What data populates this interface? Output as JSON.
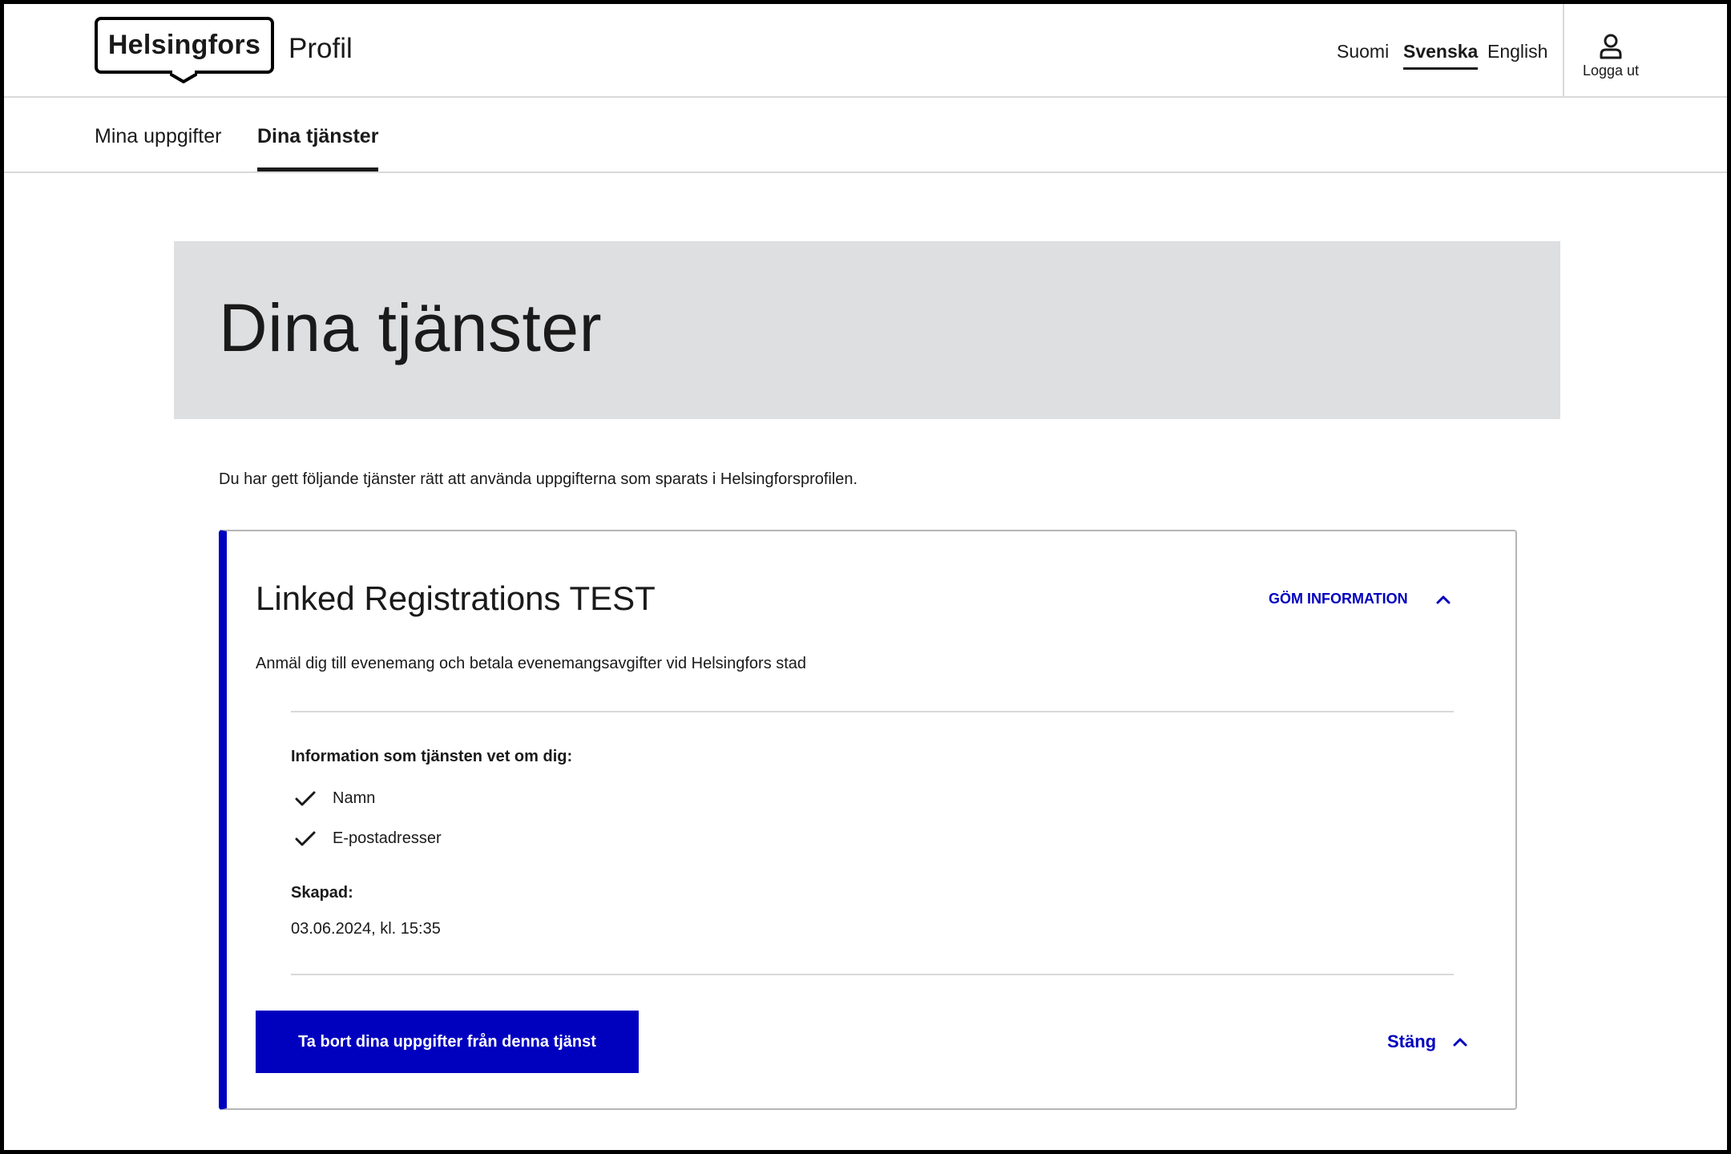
{
  "header": {
    "logo_text": "Helsingfors",
    "app_title": "Profil",
    "languages": [
      {
        "label": "Suomi"
      },
      {
        "label": "Svenska"
      },
      {
        "label": "English"
      }
    ],
    "active_language": "Svenska",
    "logout_label": "Logga ut",
    "logout_icon": "user-icon"
  },
  "tabs": [
    {
      "label": "Mina uppgifter"
    },
    {
      "label": "Dina tjänster"
    }
  ],
  "active_tab": "Dina tjänster",
  "page": {
    "title": "Dina tjänster",
    "intro": "Du har gett följande tjänster rätt att använda uppgifterna som sparats i Helsingforsprofilen."
  },
  "service": {
    "name": "Linked Registrations TEST",
    "toggle_label": "GÖM INFORMATION",
    "description": "Anmäl dig till evenemang och betala evenemangsavgifter vid Helsingfors stad",
    "info_heading": "Information som tjänsten vet om dig:",
    "permissions": [
      {
        "label": "Namn",
        "icon": "check-icon"
      },
      {
        "label": "E-postadresser",
        "icon": "check-icon"
      }
    ],
    "created_label": "Skapad:",
    "created_value": "03.06.2024, kl. 15:35",
    "delete_button": "Ta bort dina uppgifter från denna tjänst",
    "close_label": "Stäng"
  },
  "colors": {
    "accent": "#0000bf",
    "hero_background": "#dedfe1",
    "divider": "#d9d9d9",
    "text": "#1a1a1a"
  }
}
